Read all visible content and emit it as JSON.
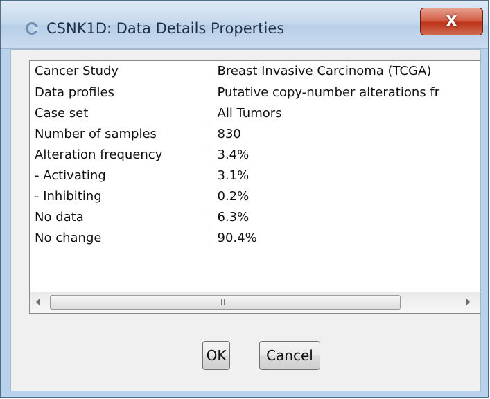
{
  "window": {
    "title": "CSNK1D: Data Details Properties",
    "close_label": "X"
  },
  "properties": [
    {
      "name": "Cancer Study",
      "value": "Breast Invasive Carcinoma (TCGA)"
    },
    {
      "name": "Data profiles",
      "value": "Putative copy-number alterations fr"
    },
    {
      "name": "Case set",
      "value": "All Tumors"
    },
    {
      "name": "Number of samples",
      "value": "830"
    },
    {
      "name": "Alteration frequency",
      "value": "3.4%"
    },
    {
      "name": " - Activating",
      "value": "3.1%"
    },
    {
      "name": " - Inhibiting",
      "value": "0.2%"
    },
    {
      "name": "No data",
      "value": "6.3%"
    },
    {
      "name": "No change",
      "value": "90.4%"
    }
  ],
  "buttons": {
    "ok_label": "OK",
    "cancel_label": "Cancel"
  },
  "colors": {
    "close_button": "#c7432a",
    "title_bar": "#c5d8ec"
  }
}
